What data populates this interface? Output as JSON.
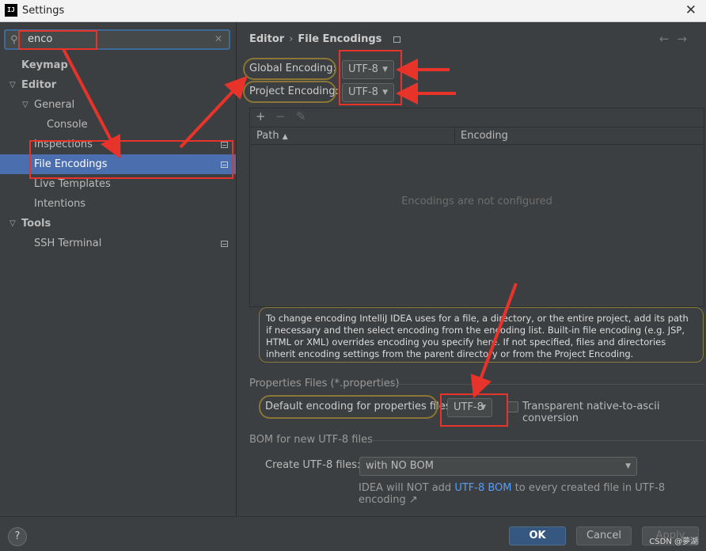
{
  "window": {
    "title": "Settings",
    "app_icon_label": "IJ"
  },
  "search": {
    "value": "enco"
  },
  "tree": [
    {
      "label": "Keymap"
    },
    {
      "label": "Editor"
    },
    {
      "label": "General"
    },
    {
      "label": "Console"
    },
    {
      "label": "Inspections"
    },
    {
      "label": "File Encodings"
    },
    {
      "label": "Live Templates"
    },
    {
      "label": "Intentions"
    },
    {
      "label": "Tools"
    },
    {
      "label": "SSH Terminal"
    }
  ],
  "breadcrumb": {
    "parent": "Editor",
    "current": "File Encodings",
    "separator": "›"
  },
  "global_encoding": {
    "label": "Global Encoding:",
    "value": "UTF-8"
  },
  "project_encoding": {
    "label": "Project Encoding:",
    "value": "UTF-8"
  },
  "table": {
    "columns": [
      "Path",
      "Encoding"
    ],
    "empty_text": "Encodings are not configured"
  },
  "info_text": "To change encoding IntelliJ IDEA uses for a file, a directory, or the entire project, add its path if necessary and then select encoding from the encoding list. Built-in file encoding (e.g. JSP, HTML or XML) overrides encoding you specify here. If not specified, files and directories inherit encoding settings from the parent directory or from the Project Encoding.",
  "properties": {
    "section_title": "Properties Files (*.properties)",
    "default_label": "Default encoding for properties files:",
    "default_value": "UTF-8",
    "transparent_label": "Transparent native-to-ascii conversion"
  },
  "bom": {
    "section_title": "BOM for new UTF-8 files",
    "create_label": "Create UTF-8 files:",
    "create_value": "with NO BOM",
    "hint_before": "IDEA will NOT add ",
    "hint_link": "UTF-8 BOM",
    "hint_after": " to every created file in UTF-8 encoding ↗"
  },
  "buttons": {
    "help": "?",
    "ok": "OK",
    "cancel": "Cancel",
    "apply": "Apply"
  },
  "watermark": "CSDN @夢湖",
  "colors": {
    "selection": "#4b6eaf",
    "annotation_red": "#e8332a",
    "link": "#589df6"
  }
}
